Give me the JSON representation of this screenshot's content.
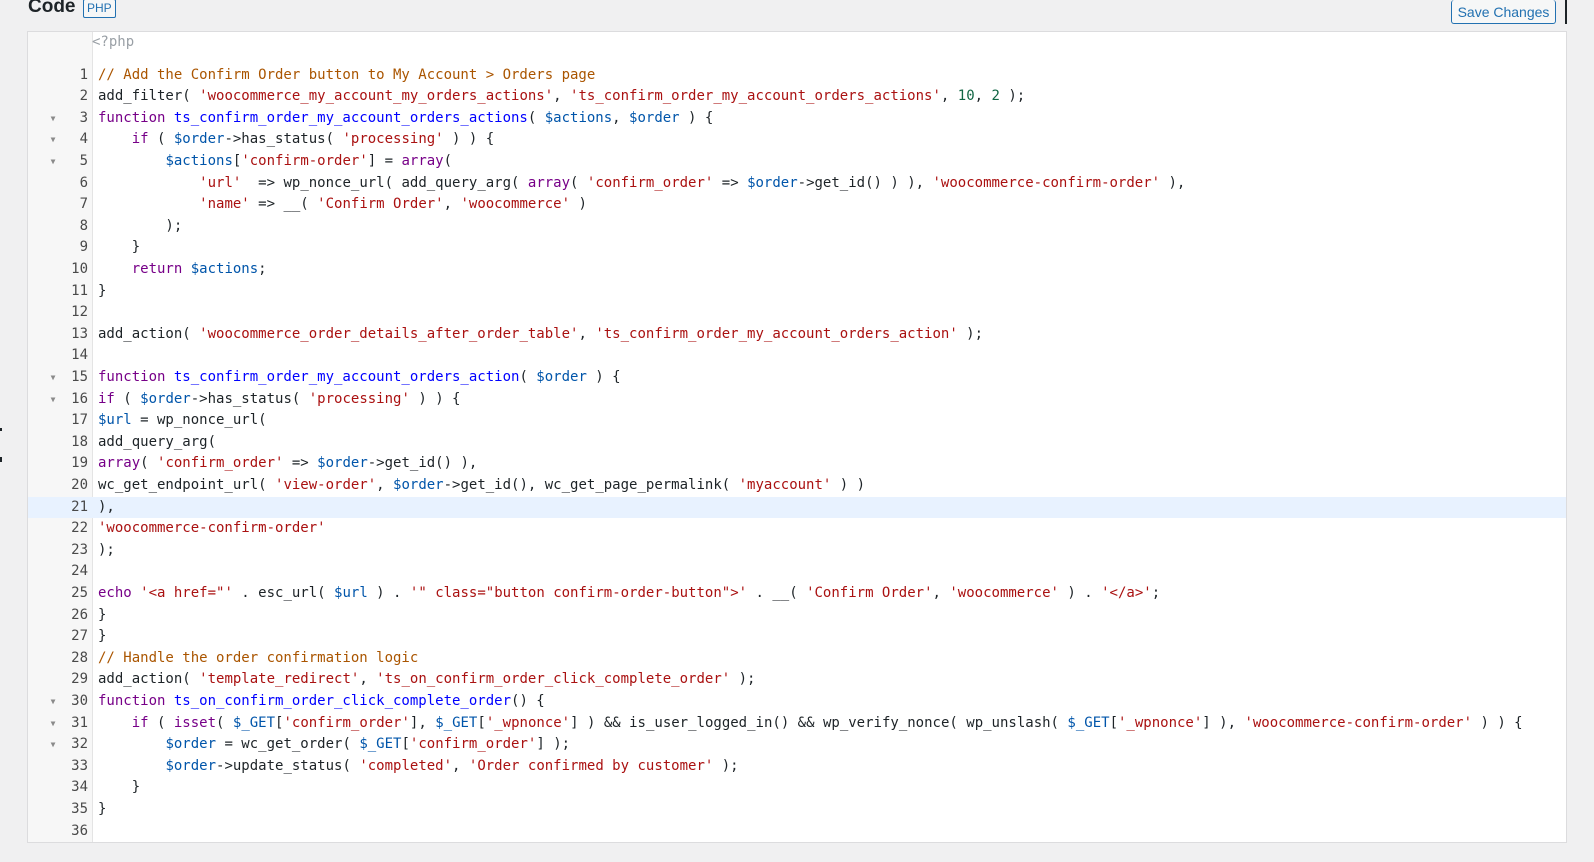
{
  "header": {
    "title": "Code",
    "language": "PHP",
    "save_label": "Save Changes"
  },
  "editor": {
    "php_open_tag": "<?php",
    "active_line": 21,
    "folds": [
      3,
      4,
      5,
      15,
      16,
      30,
      31,
      32
    ],
    "colors": {
      "keyword": "#770088",
      "string": "#aa1111",
      "variable": "#0055aa",
      "function_def": "#0000ff",
      "number": "#116644",
      "comment": "#aa5500",
      "active_line_bg": "#e8f2ff"
    },
    "lines": [
      [
        [
          "cm",
          "// Add the Confirm Order button to My Account > Orders page"
        ]
      ],
      [
        [
          "p",
          "add_filter( "
        ],
        [
          "str",
          "'woocommerce_my_account_my_orders_actions'"
        ],
        [
          "p",
          ", "
        ],
        [
          "str",
          "'ts_confirm_order_my_account_orders_actions'"
        ],
        [
          "p",
          ", "
        ],
        [
          "num",
          "10"
        ],
        [
          "p",
          ", "
        ],
        [
          "num",
          "2"
        ],
        [
          "p",
          " );"
        ]
      ],
      [
        [
          "kw",
          "function "
        ],
        [
          "fn",
          "ts_confirm_order_my_account_orders_actions"
        ],
        [
          "p",
          "( "
        ],
        [
          "var",
          "$actions"
        ],
        [
          "p",
          ", "
        ],
        [
          "var",
          "$order"
        ],
        [
          "p",
          " ) {"
        ]
      ],
      [
        [
          "p",
          "    "
        ],
        [
          "kw",
          "if"
        ],
        [
          "p",
          " ( "
        ],
        [
          "var",
          "$order"
        ],
        [
          "p",
          "->has_status( "
        ],
        [
          "str",
          "'processing'"
        ],
        [
          "p",
          " ) ) {"
        ]
      ],
      [
        [
          "p",
          "        "
        ],
        [
          "var",
          "$actions"
        ],
        [
          "p",
          "["
        ],
        [
          "str",
          "'confirm-order'"
        ],
        [
          "p",
          "] = "
        ],
        [
          "kw",
          "array"
        ],
        [
          "p",
          "("
        ]
      ],
      [
        [
          "p",
          "            "
        ],
        [
          "str",
          "'url'"
        ],
        [
          "p",
          "  => wp_nonce_url( add_query_arg( "
        ],
        [
          "kw",
          "array"
        ],
        [
          "p",
          "( "
        ],
        [
          "str",
          "'confirm_order'"
        ],
        [
          "p",
          " => "
        ],
        [
          "var",
          "$order"
        ],
        [
          "p",
          "->get_id() ) ), "
        ],
        [
          "str",
          "'woocommerce-confirm-order'"
        ],
        [
          "p",
          " ),"
        ]
      ],
      [
        [
          "p",
          "            "
        ],
        [
          "str",
          "'name'"
        ],
        [
          "p",
          " => __( "
        ],
        [
          "str",
          "'Confirm Order'"
        ],
        [
          "p",
          ", "
        ],
        [
          "str",
          "'woocommerce'"
        ],
        [
          "p",
          " )"
        ]
      ],
      [
        [
          "p",
          "        );"
        ]
      ],
      [
        [
          "p",
          "    }"
        ]
      ],
      [
        [
          "p",
          "    "
        ],
        [
          "kw",
          "return"
        ],
        [
          "p",
          " "
        ],
        [
          "var",
          "$actions"
        ],
        [
          "p",
          ";"
        ]
      ],
      [
        [
          "p",
          "}"
        ]
      ],
      [],
      [
        [
          "p",
          "add_action( "
        ],
        [
          "str",
          "'woocommerce_order_details_after_order_table'"
        ],
        [
          "p",
          ", "
        ],
        [
          "str",
          "'ts_confirm_order_my_account_orders_action'"
        ],
        [
          "p",
          " );"
        ]
      ],
      [],
      [
        [
          "kw",
          "function "
        ],
        [
          "fn",
          "ts_confirm_order_my_account_orders_action"
        ],
        [
          "p",
          "( "
        ],
        [
          "var",
          "$order"
        ],
        [
          "p",
          " ) {"
        ]
      ],
      [
        [
          "kw",
          "if"
        ],
        [
          "p",
          " ( "
        ],
        [
          "var",
          "$order"
        ],
        [
          "p",
          "->has_status( "
        ],
        [
          "str",
          "'processing'"
        ],
        [
          "p",
          " ) ) {"
        ]
      ],
      [
        [
          "var",
          "$url"
        ],
        [
          "p",
          " = wp_nonce_url("
        ]
      ],
      [
        [
          "p",
          "add_query_arg("
        ]
      ],
      [
        [
          "kw",
          "array"
        ],
        [
          "p",
          "( "
        ],
        [
          "str",
          "'confirm_order'"
        ],
        [
          "p",
          " => "
        ],
        [
          "var",
          "$order"
        ],
        [
          "p",
          "->get_id() ),"
        ]
      ],
      [
        [
          "p",
          "wc_get_endpoint_url( "
        ],
        [
          "str",
          "'view-order'"
        ],
        [
          "p",
          ", "
        ],
        [
          "var",
          "$order"
        ],
        [
          "p",
          "->get_id(), wc_get_page_permalink( "
        ],
        [
          "str",
          "'myaccount'"
        ],
        [
          "p",
          " ) )"
        ]
      ],
      [
        [
          "p",
          "),"
        ]
      ],
      [
        [
          "str",
          "'woocommerce-confirm-order'"
        ]
      ],
      [
        [
          "p",
          ");"
        ]
      ],
      [],
      [
        [
          "kw",
          "echo"
        ],
        [
          "p",
          " "
        ],
        [
          "str",
          "'<a href=\"'"
        ],
        [
          "p",
          " . esc_url( "
        ],
        [
          "var",
          "$url"
        ],
        [
          "p",
          " ) . "
        ],
        [
          "str",
          "'\" class=\"button confirm-order-button\">'"
        ],
        [
          "p",
          " . __( "
        ],
        [
          "str",
          "'Confirm Order'"
        ],
        [
          "p",
          ", "
        ],
        [
          "str",
          "'woocommerce'"
        ],
        [
          "p",
          " ) . "
        ],
        [
          "str",
          "'</a>'"
        ],
        [
          "p",
          ";"
        ]
      ],
      [
        [
          "p",
          "}"
        ]
      ],
      [
        [
          "p",
          "}"
        ]
      ],
      [
        [
          "cm",
          "// Handle the order confirmation logic"
        ]
      ],
      [
        [
          "p",
          "add_action( "
        ],
        [
          "str",
          "'template_redirect'"
        ],
        [
          "p",
          ", "
        ],
        [
          "str",
          "'ts_on_confirm_order_click_complete_order'"
        ],
        [
          "p",
          " );"
        ]
      ],
      [
        [
          "kw",
          "function "
        ],
        [
          "fn",
          "ts_on_confirm_order_click_complete_order"
        ],
        [
          "p",
          "() {"
        ]
      ],
      [
        [
          "p",
          "    "
        ],
        [
          "kw",
          "if"
        ],
        [
          "p",
          " ( "
        ],
        [
          "kw",
          "isset"
        ],
        [
          "p",
          "( "
        ],
        [
          "var",
          "$_GET"
        ],
        [
          "p",
          "["
        ],
        [
          "str",
          "'confirm_order'"
        ],
        [
          "p",
          "], "
        ],
        [
          "var",
          "$_GET"
        ],
        [
          "p",
          "["
        ],
        [
          "str",
          "'_wpnonce'"
        ],
        [
          "p",
          "] ) && is_user_logged_in() && wp_verify_nonce( wp_unslash( "
        ],
        [
          "var",
          "$_GET"
        ],
        [
          "p",
          "["
        ],
        [
          "str",
          "'_wpnonce'"
        ],
        [
          "p",
          "] ), "
        ],
        [
          "str",
          "'woocommerce-confirm-order'"
        ],
        [
          "p",
          " ) ) {"
        ]
      ],
      [
        [
          "p",
          "        "
        ],
        [
          "var",
          "$order"
        ],
        [
          "p",
          " = wc_get_order( "
        ],
        [
          "var",
          "$_GET"
        ],
        [
          "p",
          "["
        ],
        [
          "str",
          "'confirm_order'"
        ],
        [
          "p",
          "] );"
        ]
      ],
      [
        [
          "p",
          "        "
        ],
        [
          "var",
          "$order"
        ],
        [
          "p",
          "->update_status( "
        ],
        [
          "str",
          "'completed'"
        ],
        [
          "p",
          ", "
        ],
        [
          "str",
          "'Order confirmed by customer'"
        ],
        [
          "p",
          " );"
        ]
      ],
      [
        [
          "p",
          "    }"
        ]
      ],
      [
        [
          "p",
          "}"
        ]
      ],
      []
    ]
  }
}
